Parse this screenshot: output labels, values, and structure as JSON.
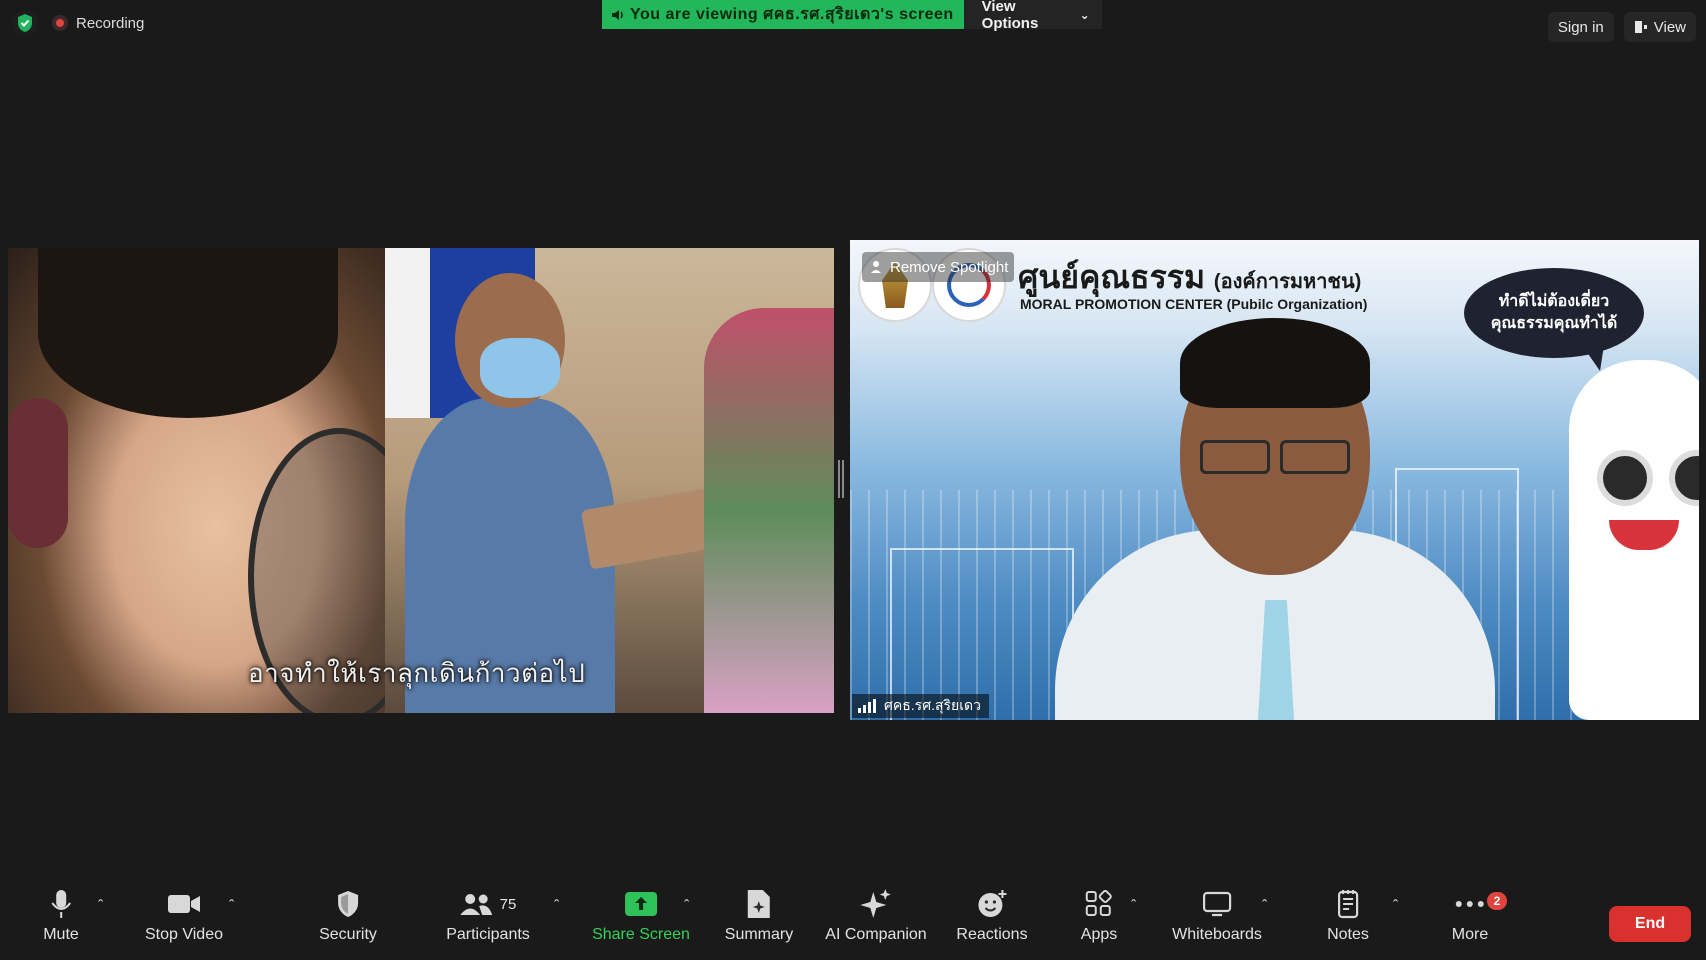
{
  "top": {
    "recording_label": "Recording",
    "viewing_banner": "You are viewing ศคธ.รศ.สุริยเดว's screen",
    "view_options": "View Options",
    "sign_in": "Sign in",
    "view": "View"
  },
  "left_tile": {
    "subtitle": "อาจทำให้เราลุกเดินก้าวต่อไป"
  },
  "right_tile": {
    "org_name_th": "ศูนย์คุณธรรม",
    "org_type_th": "(องค์การมหาชน)",
    "org_name_en": "MORAL PROMOTION CENTER  (Pubilc Organization)",
    "remove_spotlight": "Remove Spotlight",
    "bubble_line1": "ทำดีไม่ต้องเดี่ยว",
    "bubble_line2": "คุณธรรมคุณทำได้",
    "participant_name": "ศคธ.รศ.สุริยเดว"
  },
  "toolbar": {
    "mute": "Mute",
    "stop_video": "Stop Video",
    "security": "Security",
    "participants": "Participants",
    "participants_count": "75",
    "share_screen": "Share Screen",
    "summary": "Summary",
    "ai_companion": "AI Companion",
    "reactions": "Reactions",
    "apps": "Apps",
    "whiteboards": "Whiteboards",
    "notes": "Notes",
    "more": "More",
    "more_badge": "2",
    "end": "End"
  },
  "colors": {
    "accent_green": "#21b75a",
    "end_red": "#d9312d",
    "background": "#1a1a1a"
  }
}
